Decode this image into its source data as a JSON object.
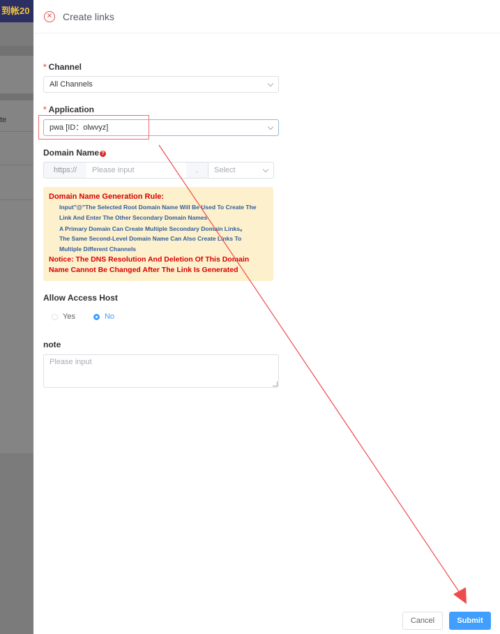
{
  "background": {
    "banner_text": "到帐20",
    "side_text": "te"
  },
  "drawer": {
    "title": "Create links",
    "close_icon": "close-circle-icon"
  },
  "form": {
    "required_mark": "*",
    "channel": {
      "label": "Channel",
      "value": "All Channels"
    },
    "application": {
      "label": "Application",
      "value": "pwa [ID：olwvyz]"
    },
    "domain_name": {
      "label": "Domain Name",
      "help_icon": "?",
      "prefix": "https://",
      "placeholder": "Please input",
      "separator": ".",
      "select_placeholder": "Select"
    },
    "rule": {
      "title": "Domain Name Generation Rule:",
      "lines": [
        "Input\"@\"The Selected Root Domain Name Will Be Used To Create The",
        "Link And Enter The Other Secondary Domain Names",
        "A Primary Domain Can Create Multiple Secondary Domain Links。",
        "The Same Second-Level Domain Name Can Also Create Links To",
        "Multiple Different Channels"
      ],
      "notice_lines": [
        "Notice:  The DNS Resolution And Deletion Of This Domain",
        "Name Cannot Be Changed After The Link Is Generated"
      ]
    },
    "allow_access_host": {
      "label": "Allow Access Host",
      "options": [
        "Yes",
        "No"
      ],
      "selected": "No"
    },
    "note": {
      "label": "note",
      "placeholder": "Please input"
    }
  },
  "footer": {
    "cancel_label": "Cancel",
    "submit_label": "Submit"
  },
  "colors": {
    "primary": "#409eff",
    "required": "#f56c6c",
    "notice": "#d60000",
    "rule_background": "#fdf0cc",
    "annotation": "#ee4b4b"
  }
}
